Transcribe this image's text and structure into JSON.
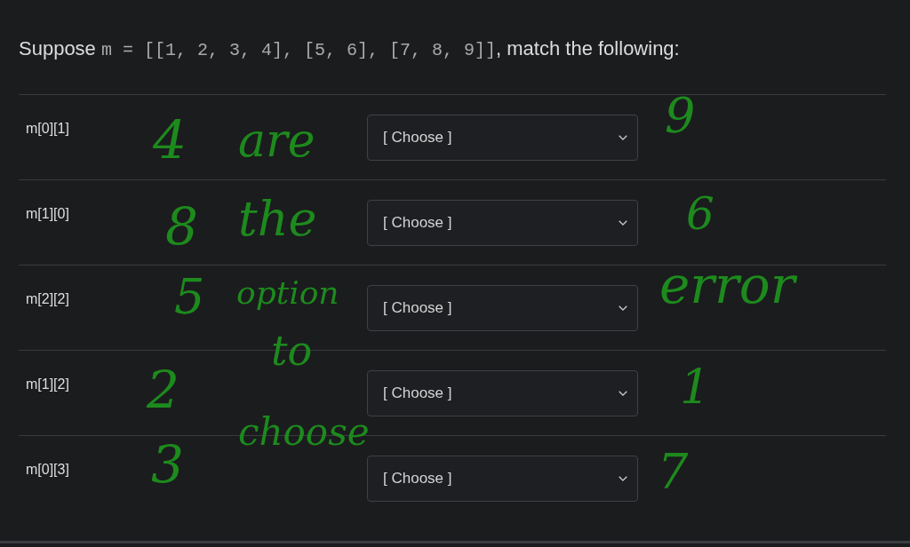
{
  "question": {
    "prefix": "Suppose",
    "code": "m = [[1, 2, 3, 4], [5, 6], [7, 8, 9]]",
    "suffix": ", match the following:"
  },
  "rows": [
    {
      "label": "m[0][1]",
      "select": {
        "value": "[ Choose ]"
      }
    },
    {
      "label": "m[1][0]",
      "select": {
        "value": "[ Choose ]"
      }
    },
    {
      "label": "m[2][2]",
      "select": {
        "value": "[ Choose ]"
      }
    },
    {
      "label": "m[1][2]",
      "select": {
        "value": "[ Choose ]"
      }
    },
    {
      "label": "m[0][3]",
      "select": {
        "value": "[ Choose ]"
      }
    }
  ],
  "handwriting": [
    "4",
    "are",
    "9",
    "8",
    "the",
    "6",
    "5",
    "option",
    "error",
    "to",
    "2",
    "1",
    "choose",
    "3",
    "7"
  ]
}
